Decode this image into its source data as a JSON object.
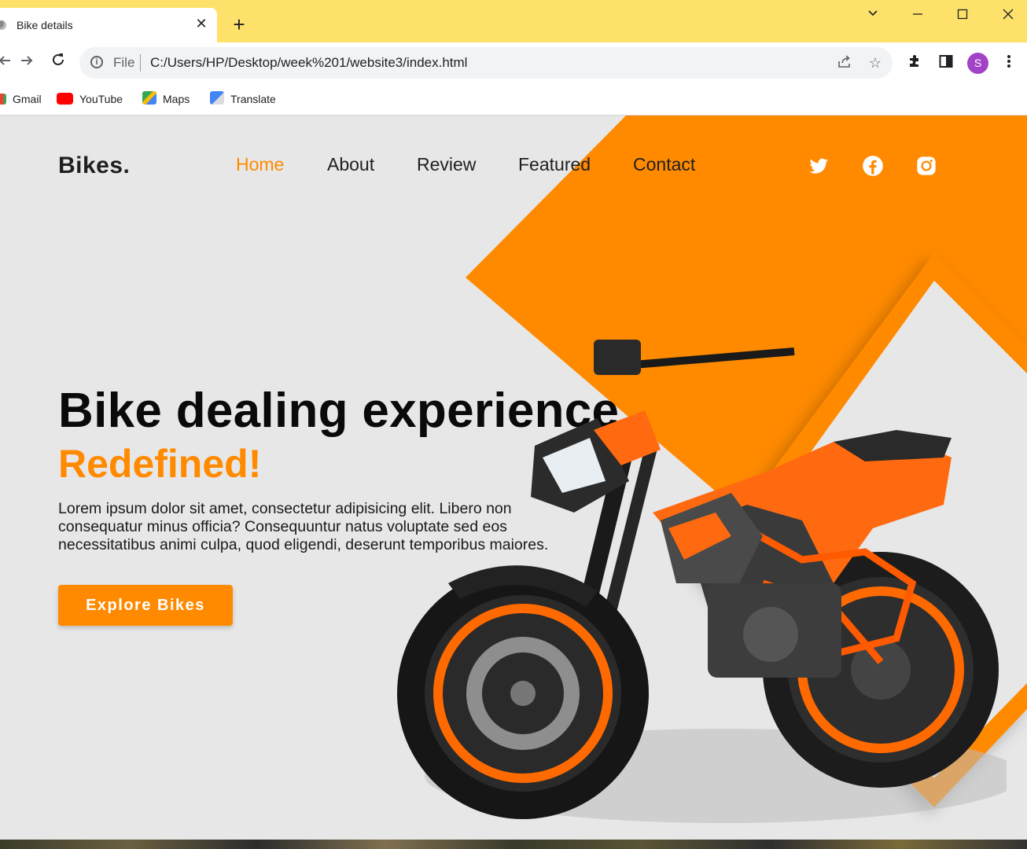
{
  "browser": {
    "tab_title": "Bike details",
    "url_scheme": "File",
    "url": "C:/Users/HP/Desktop/week%201/website3/index.html",
    "profile_initial": "S",
    "bookmarks": [
      {
        "label": "Gmail",
        "icon": "gmail-icon"
      },
      {
        "label": "YouTube",
        "icon": "youtube-icon"
      },
      {
        "label": "Maps",
        "icon": "maps-icon"
      },
      {
        "label": "Translate",
        "icon": "translate-icon"
      }
    ]
  },
  "site": {
    "logo": "Bikes.",
    "nav": [
      "Home",
      "About",
      "Review",
      "Featured",
      "Contact"
    ],
    "active_nav": "Home",
    "social": [
      "twitter-icon",
      "facebook-icon",
      "instagram-icon"
    ],
    "hero": {
      "title": "Bike dealing experience",
      "subtitle": "Redefined!",
      "text": "Lorem ipsum dolor sit amet, consectetur adipisicing elit. Libero non consequatur minus officia? Consequuntur natus voluptate sed eos necessitatibus animi culpa, quod eligendi, deserunt temporibus maiores.",
      "cta": "Explore Bikes"
    }
  },
  "colors": {
    "accent": "#ff8a00",
    "page_bg": "#e7e7e7",
    "tabbar_bg": "#fde16a",
    "text_dark": "#1f1f1f"
  }
}
